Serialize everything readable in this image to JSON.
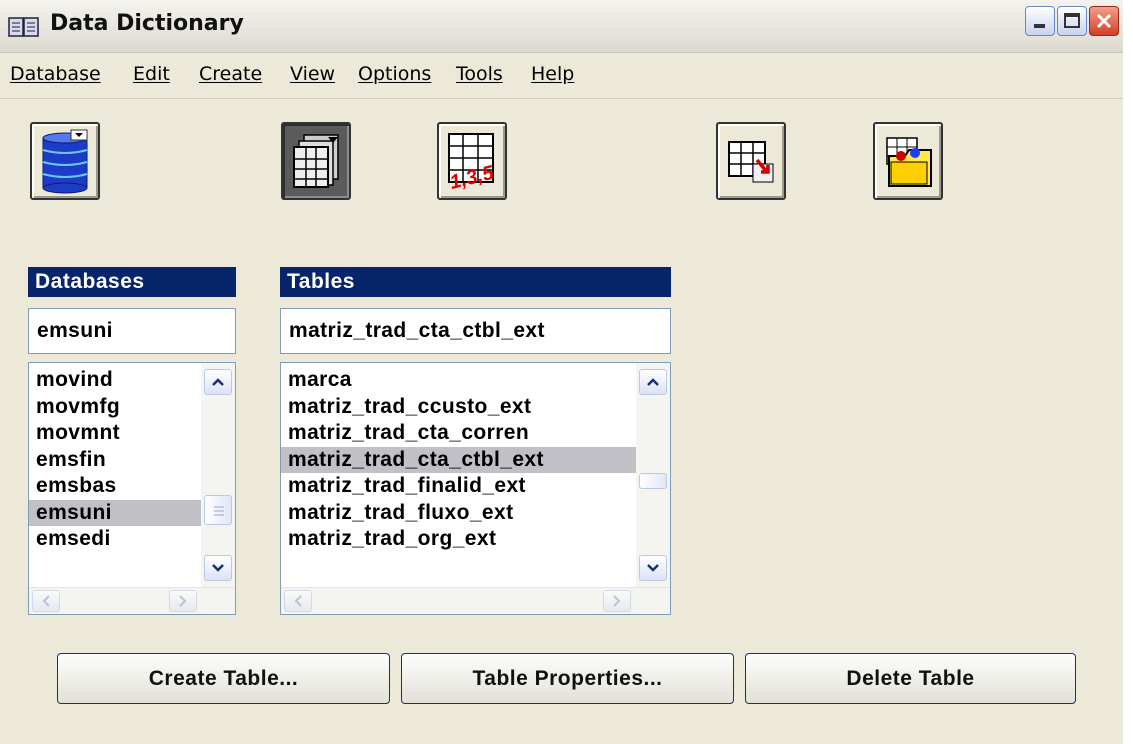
{
  "window": {
    "title": "Data Dictionary"
  },
  "menu": [
    "Database",
    "Edit",
    "Create",
    "View",
    "Options",
    "Tools",
    "Help"
  ],
  "toolbar": {
    "buttons": [
      {
        "name": "databases-button",
        "icon": "database-icon",
        "pressed": false
      },
      {
        "name": "tables-button",
        "icon": "tables-icon",
        "pressed": true
      },
      {
        "name": "sequence-button",
        "icon": "sequence-table-icon",
        "label": "1,3,5",
        "pressed": false
      },
      {
        "name": "export-button",
        "icon": "table-export-icon",
        "pressed": false
      },
      {
        "name": "folder-button",
        "icon": "folder-icon",
        "pressed": false
      }
    ]
  },
  "databases": {
    "header": "Databases",
    "current": "emsuni",
    "items": [
      "movind",
      "movmfg",
      "movmnt",
      "emsfin",
      "emsbas",
      "emsuni",
      "emsedi"
    ],
    "selected": "emsuni"
  },
  "tables": {
    "header": "Tables",
    "current": "matriz_trad_cta_ctbl_ext",
    "items": [
      "marca",
      "matriz_trad_ccusto_ext",
      "matriz_trad_cta_corren",
      "matriz_trad_cta_ctbl_ext",
      "matriz_trad_finalid_ext",
      "matriz_trad_fluxo_ext",
      "matriz_trad_org_ext"
    ],
    "selected": "matriz_trad_cta_ctbl_ext"
  },
  "buttons": {
    "create": "Create Table...",
    "properties": "Table Properties...",
    "delete": "Delete Table"
  },
  "colors": {
    "panel_header": "#08246b",
    "selection": "#c0c0c6",
    "window_bg": "#ece9d8"
  }
}
